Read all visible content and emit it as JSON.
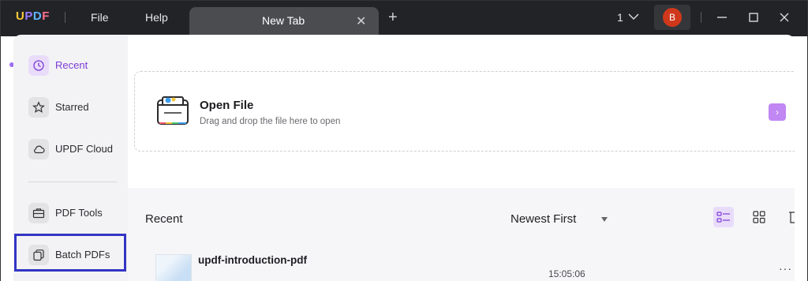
{
  "titlebar": {
    "logo": "UPDF",
    "menu": [
      {
        "label": "File"
      },
      {
        "label": "Help"
      }
    ],
    "tab": {
      "label": "New Tab"
    },
    "page_count": "1",
    "avatar_initial": "B"
  },
  "sidebar": {
    "items": [
      {
        "label": "Recent",
        "icon": "clock-icon",
        "active": true
      },
      {
        "label": "Starred",
        "icon": "star-icon"
      },
      {
        "label": "UPDF Cloud",
        "icon": "cloud-icon"
      },
      {
        "label": "PDF Tools",
        "icon": "toolbox-icon"
      },
      {
        "label": "Batch PDFs",
        "icon": "batch-icon"
      }
    ]
  },
  "open_file": {
    "title": "Open File",
    "subtitle": "Drag and drop the file here to open"
  },
  "recent": {
    "title": "Recent",
    "sort": "Newest First",
    "files": [
      {
        "name": "updf-introduction-pdf",
        "time": "15:05:06"
      }
    ]
  },
  "colors": {
    "accent": "#7d3bd6",
    "highlight": "#3335c4",
    "titlebar": "#222327"
  }
}
